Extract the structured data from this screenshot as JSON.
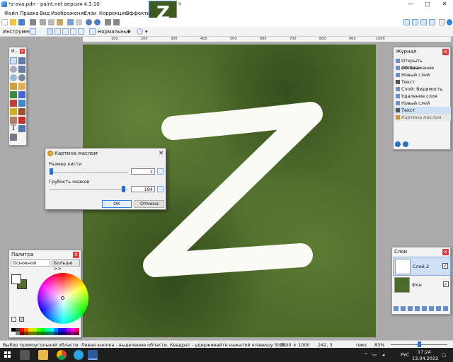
{
  "window": {
    "title": "*z-ava.pdn - paint.net версия 4.3.10",
    "min": "—",
    "max": "□",
    "close": "✕"
  },
  "menu": [
    "Файл",
    "Правка",
    "Вид",
    "Изображение",
    "Слои",
    "Коррекция",
    "Эффекты"
  ],
  "thumbnail": {
    "glyph": "Z",
    "close": "✕"
  },
  "options": {
    "tool_label": "Инструмент:",
    "blend_mode": "Нормальный"
  },
  "ruler": [
    "100",
    "200",
    "300",
    "400",
    "500",
    "600",
    "700",
    "800",
    "900",
    "1000"
  ],
  "canvas": {
    "letter": "Z",
    "bg_color": "#4d6a2a",
    "stroke_color": "#ffffff"
  },
  "tools_panel": {
    "title": "И...",
    "close": "x"
  },
  "history": {
    "title": "Журнал",
    "close": "x",
    "items": [
      "Открыть изображение",
      "Облака",
      "Новый слой",
      "Текст",
      "Слой: Видимость",
      "Удаление слоя",
      "Новый слой",
      "Текст",
      "Картина маслом"
    ],
    "selected_index": 7,
    "undone_index": 8
  },
  "dialog": {
    "title": "Картина маслом",
    "close": "✕",
    "brush_size_label": "Размер кисти",
    "brush_size_value": "1",
    "brush_size_fraction": 0.0,
    "coarseness_label": "Грубость мазков",
    "coarseness_value": "194",
    "coarseness_fraction": 0.97,
    "ok": "ОК",
    "cancel": "Отмена"
  },
  "palette": {
    "title": "Палитра",
    "close": "x",
    "mode": "Основной",
    "more": "Больше >>",
    "primary_color": "#ffffff",
    "secondary_color": "#556b2f"
  },
  "layers": {
    "title": "Слои",
    "close": "x",
    "items": [
      {
        "name": "Слой 2",
        "visible": "✓"
      },
      {
        "name": "Фон",
        "visible": "✓"
      }
    ]
  },
  "status": {
    "message": "Выбор прямоугольной области. Левая кнопка - выделение области. Квадрат - удерживайте нажатой клавишу Shift.",
    "image_size": "1000 × 1000",
    "cursor_pos": "242, 3",
    "units": "пикс",
    "zoom": "83%"
  },
  "taskbar": {
    "lang": "РУС",
    "time": "17:24",
    "date": "13.04.2022"
  },
  "colors": {
    "accent": "#2e6fc1",
    "selection": "#cfe0f6",
    "close_red": "#e23d3d"
  }
}
